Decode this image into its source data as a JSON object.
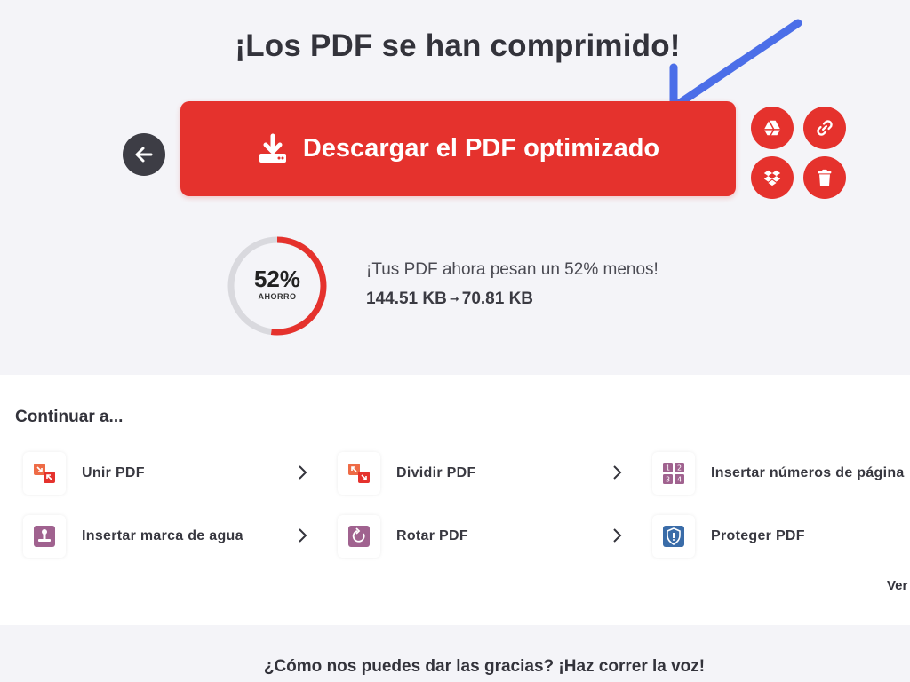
{
  "header": {
    "title": "¡Los PDF se han comprimido!"
  },
  "download": {
    "label": "Descargar el PDF optimizado",
    "icon": "download-icon"
  },
  "share_actions": [
    {
      "name": "google-drive-icon"
    },
    {
      "name": "link-icon"
    },
    {
      "name": "dropbox-icon"
    },
    {
      "name": "trash-icon"
    }
  ],
  "result": {
    "percent_label": "52%",
    "percent_value": 52,
    "savings_label": "AHORRO",
    "message": "¡Tus PDF ahora pesan un 52% menos!",
    "size_before": "144.51 KB",
    "size_after": "70.81 KB"
  },
  "continue": {
    "title": "Continuar a...",
    "tools": [
      {
        "label": "Unir PDF",
        "icon": "merge-pdf-icon"
      },
      {
        "label": "Dividir PDF",
        "icon": "split-pdf-icon"
      },
      {
        "label": "Insertar números de página",
        "icon": "page-numbers-icon"
      },
      {
        "label": "Insertar marca de agua",
        "icon": "watermark-icon"
      },
      {
        "label": "Rotar PDF",
        "icon": "rotate-pdf-icon"
      },
      {
        "label": "Proteger PDF",
        "icon": "protect-pdf-icon"
      }
    ],
    "see_more": "Ver"
  },
  "footer": {
    "thanks": "¿Cómo nos puedes dar las gracias? ¡Haz correr la voz!"
  },
  "colors": {
    "brand_red": "#e5322d",
    "annotation_blue": "#4169e1",
    "dark": "#33333b"
  }
}
